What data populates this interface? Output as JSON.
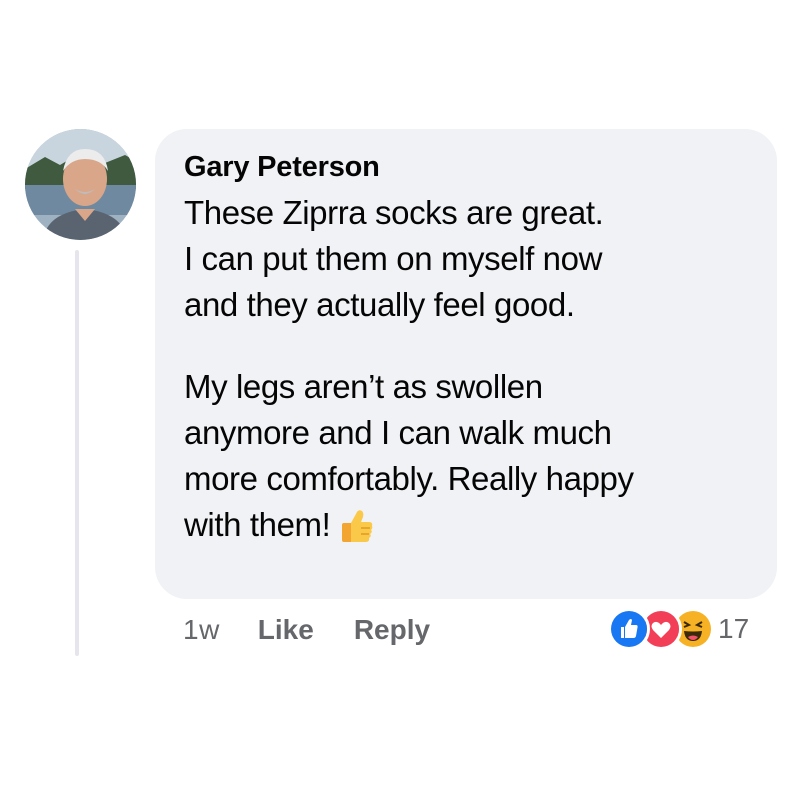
{
  "comment": {
    "author": "Gary Peterson",
    "paragraph_1": [
      "These Ziprra socks are great.",
      "I can put them on myself now",
      "and they actually feel good."
    ],
    "paragraph_2": [
      "My legs aren’t as swollen",
      "anymore and I can walk much",
      "more comfortably. Really happy",
      "with them!"
    ],
    "emoji": "thumbs-up"
  },
  "actions": {
    "time": "1w",
    "like_label": "Like",
    "reply_label": "Reply"
  },
  "reactions": {
    "types": [
      "like",
      "love",
      "haha"
    ],
    "count": "17"
  },
  "colors": {
    "bubble": "#f0f2f5",
    "meta_text": "#65676b",
    "like_blue": "#1877f2",
    "love_red": "#f33e58",
    "haha_yellow": "#f7b125"
  }
}
